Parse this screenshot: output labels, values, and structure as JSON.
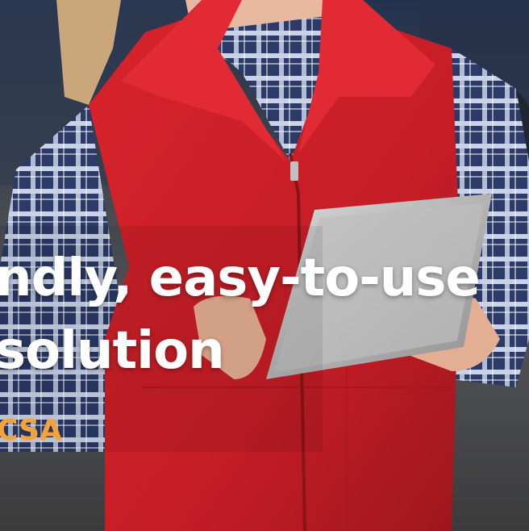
{
  "headline": {
    "line1": "ndly, easy-to-use",
    "line2": "solution"
  },
  "brand": {
    "text": "CSA",
    "color": "#f5a23a"
  },
  "photo": {
    "subject": "woman-with-tablet-icon"
  }
}
